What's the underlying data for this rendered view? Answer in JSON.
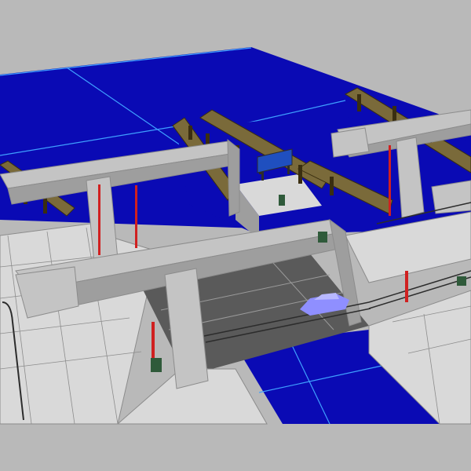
{
  "scene": {
    "colors": {
      "background": "#b9b9b9",
      "water": "#0a0ab4",
      "water_grid": "#3fa0ff",
      "quay": "#d9d9d9",
      "quay_edge": "#8c8c8c",
      "road": "#5a5a5a",
      "road_marking": "#9a9a9a",
      "concrete": "#c4c4c4",
      "concrete_shadow": "#9e9e9e",
      "fender": "#7a6a3a",
      "fender_dark": "#3a2e10",
      "railing": "#2c2c2c",
      "sign_blue": "#1f4fbf",
      "car": "#8f8fff",
      "signal_red": "#d02020",
      "signal_white": "#f0f0f0",
      "box_green": "#2f5a3a"
    },
    "objects": {
      "bridges": 2,
      "vehicles": [
        "car"
      ],
      "signs": [
        "overhead-sign"
      ]
    }
  }
}
